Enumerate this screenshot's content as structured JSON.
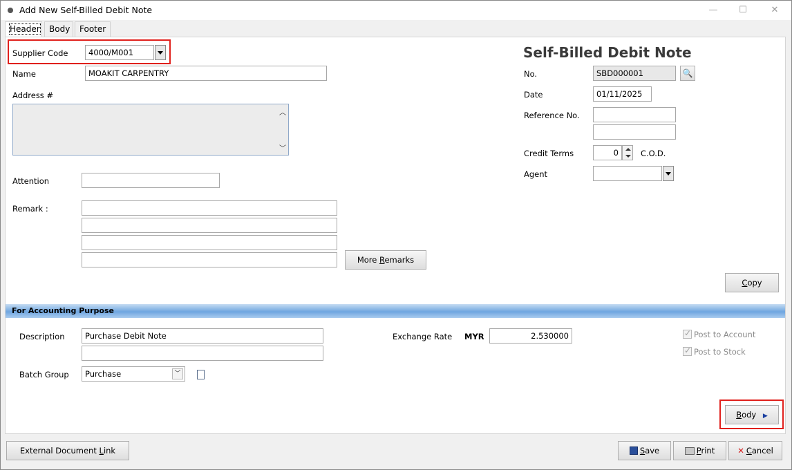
{
  "window": {
    "title": "Add New Self-Billed Debit Note",
    "minimize_icon": "—",
    "maximize_icon": "☐",
    "close_icon": "✕"
  },
  "tabs": [
    "Header",
    "Body",
    "Footer"
  ],
  "header": {
    "heading": "Self-Billed Debit Note",
    "supplier_code_label": "Supplier Code",
    "supplier_code_value": "4000/M001",
    "name_label": "Name",
    "name_value": "MOAKIT CARPENTRY",
    "address_label": "Address #",
    "attention_label": "Attention",
    "remark_label": "Remark :",
    "more_remarks_button": {
      "pre": "More ",
      "key": "R",
      "post": "emarks"
    },
    "no_label": "No.",
    "no_value": "SBD000001",
    "date_label": "Date",
    "date_value": "01/11/2025",
    "reference_label": "Reference No.",
    "credit_terms_label": "Credit Terms",
    "credit_terms_value": "0",
    "credit_terms_unit": "C.O.D.",
    "agent_label": "Agent",
    "copy_button": {
      "key": "C",
      "post": "opy"
    }
  },
  "accounting": {
    "section_title": "For Accounting Purpose",
    "description_label": "Description",
    "description_value": "Purchase Debit Note",
    "batch_group_label": "Batch Group",
    "batch_group_value": "Purchase",
    "exchange_rate_label": "Exchange Rate",
    "currency": "MYR",
    "exchange_rate_value": "2.530000",
    "post_to_account_label": "Post to Account",
    "post_to_stock_label": "Post to Stock",
    "post_to_account_checked": true,
    "post_to_stock_checked": true,
    "body_button": {
      "key": "B",
      "post": "ody"
    }
  },
  "footer": {
    "external_link_button": {
      "pre": "External Document ",
      "key": "L",
      "post": "ink"
    },
    "save_button": {
      "key": "S",
      "post": "ave"
    },
    "print_button": {
      "key": "P",
      "post": "rint"
    },
    "cancel_button": {
      "key": "C",
      "post": "ancel"
    }
  },
  "colors": {
    "highlight_box": "#e0201c",
    "section_bar": "#6fa6e0"
  }
}
